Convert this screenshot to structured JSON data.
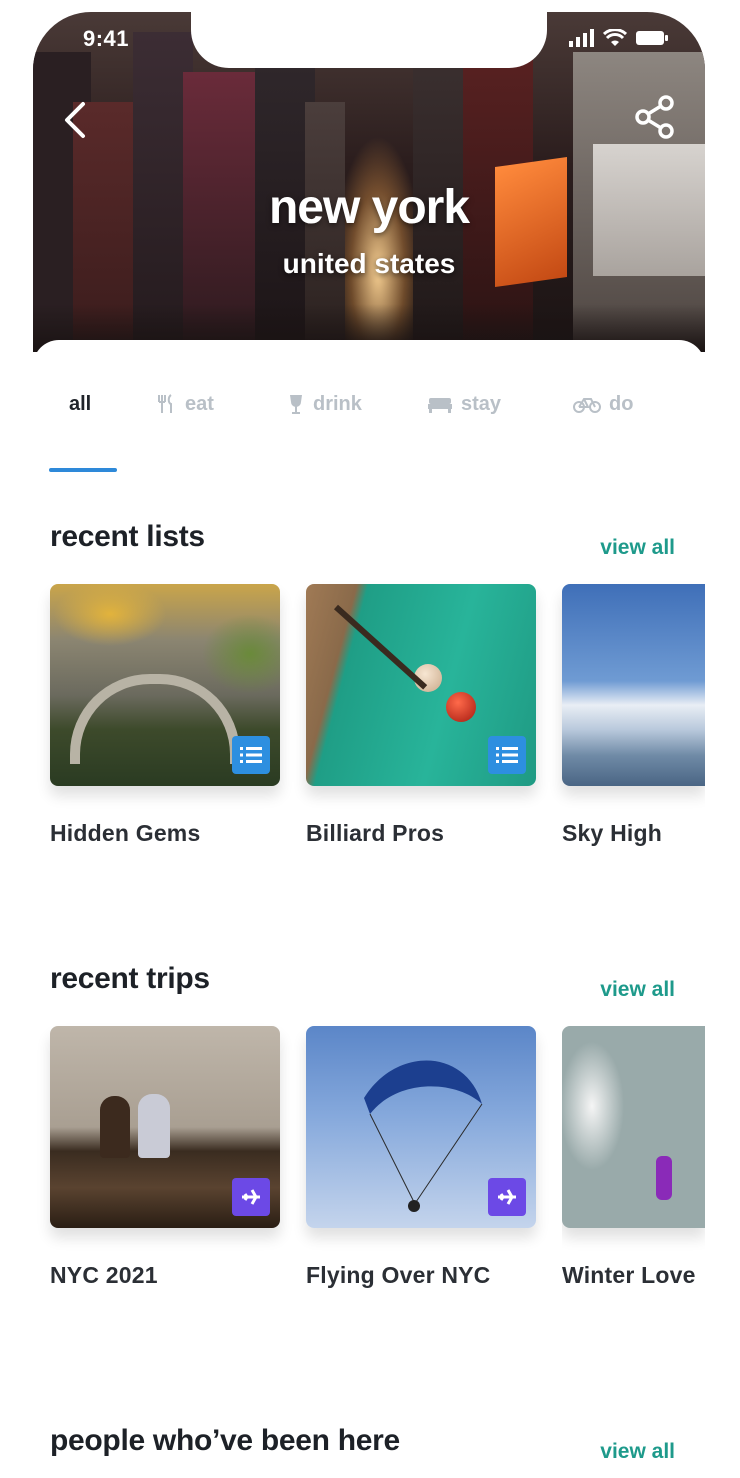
{
  "status": {
    "time": "9:41"
  },
  "hero": {
    "title": "new york",
    "subtitle": "united states"
  },
  "tabs": [
    {
      "label": "all",
      "icon": "grid",
      "active": true
    },
    {
      "label": "eat",
      "icon": "utensils-icon"
    },
    {
      "label": "drink",
      "icon": "wine-glass-icon"
    },
    {
      "label": "stay",
      "icon": "bed-icon"
    },
    {
      "label": "do",
      "icon": "bicycle-icon"
    }
  ],
  "recent_lists": {
    "title": "recent lists",
    "view_all": "view all",
    "items": [
      {
        "label": "Hidden Gems",
        "badge": "list-icon"
      },
      {
        "label": "Billiard Pros",
        "badge": "list-icon"
      },
      {
        "label": "Sky High",
        "badge": "list-icon"
      }
    ]
  },
  "recent_trips": {
    "title": "recent trips",
    "view_all": "view all",
    "items": [
      {
        "label": "NYC 2021",
        "badge": "plane-icon"
      },
      {
        "label": "Flying Over NYC",
        "badge": "plane-icon"
      },
      {
        "label": "Winter Love",
        "badge": "plane-icon"
      }
    ]
  },
  "people": {
    "title": "people who’ve been here",
    "view_all": "view all"
  },
  "colors": {
    "accent_blue": "#2e89d9",
    "link_teal": "#1e9a8b",
    "list_badge": "#2d8fe0",
    "trip_badge": "#6c49e6"
  }
}
